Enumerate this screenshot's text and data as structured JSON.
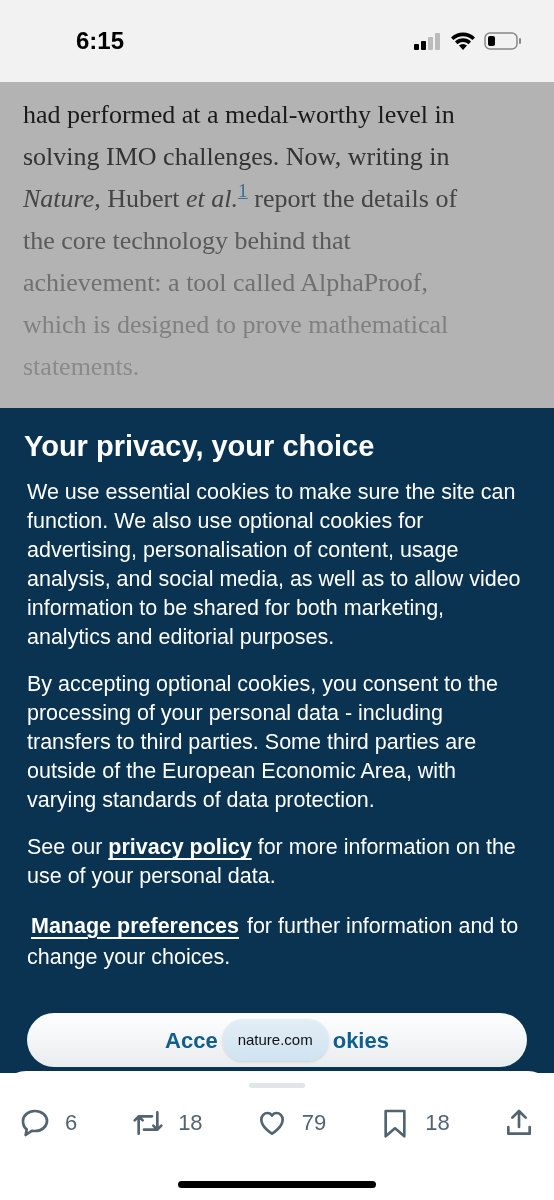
{
  "status_bar": {
    "time": "6:15"
  },
  "article_lines": [
    "had performed at a medal-worthy level in",
    "solving IMO challenges. Now, writing in",
    "*Nature*, Hubert *et al.*$^{1}$ report the details of",
    "the core technology behind that",
    "achievement: a tool called AlphaProof,",
    "which is designed to prove mathematical",
    "statements."
  ],
  "cookie_banner": {
    "title": "Your privacy, your choice",
    "paragraphs": [
      "We use essential cookies to make sure the site can function. We also use optional cookies for advertising, personalisation of content, usage analysis, and social media, as well as to allow video information to be shared for both marketing, analytics and editorial purposes.",
      "By accepting optional cookies, you consent to the processing of your personal data - including transfers to third parties. Some third parties are outside of the European Economic Area, with varying standards of data protection."
    ],
    "policy_line": {
      "before": "See our",
      "link": "privacy policy",
      "after": "for more information on the use of your personal data."
    },
    "preferences_line": {
      "link": "Manage preferences",
      "after": "for further information and to change your choices."
    },
    "accept_button": {
      "label_parts": [
        "Acce",
        "okies"
      ]
    }
  },
  "url_pill": "nature.com",
  "actions": [
    {
      "kind": "reply",
      "count": "6"
    },
    {
      "kind": "repost",
      "count": "18"
    },
    {
      "kind": "like",
      "count": "79"
    },
    {
      "kind": "bookmark",
      "count": "18"
    },
    {
      "kind": "share"
    }
  ]
}
